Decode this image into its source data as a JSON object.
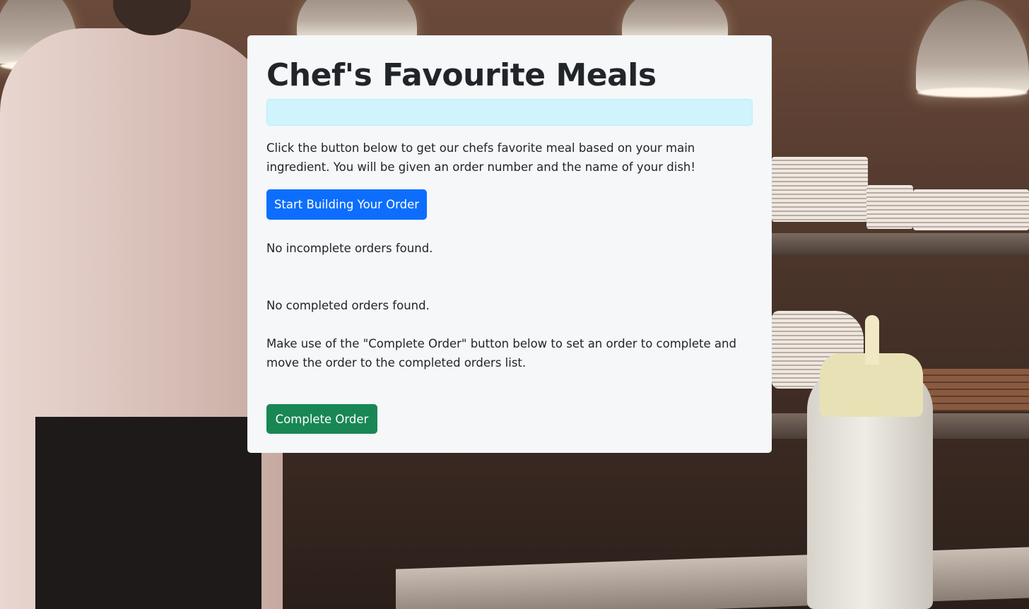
{
  "page": {
    "title": "Chef's Favourite Meals",
    "intro_text": "Click the button below to get our chefs favorite meal based on your main ingredient. You will be given an order number and the name of your dish!",
    "alert_text": ""
  },
  "actions": {
    "start_label": "Start Building Your Order",
    "complete_label": "Complete Order"
  },
  "orders": {
    "incomplete_status": "No incomplete orders found.",
    "completed_status": "No completed orders found.",
    "complete_hint": "Make use of the \"Complete Order\" button below to set an order to complete and move the order to the completed orders list."
  },
  "colors": {
    "primary": "#0d6efd",
    "success": "#198754",
    "alert_info": "#cff4fc",
    "card_bg": "#f5f7f9"
  }
}
